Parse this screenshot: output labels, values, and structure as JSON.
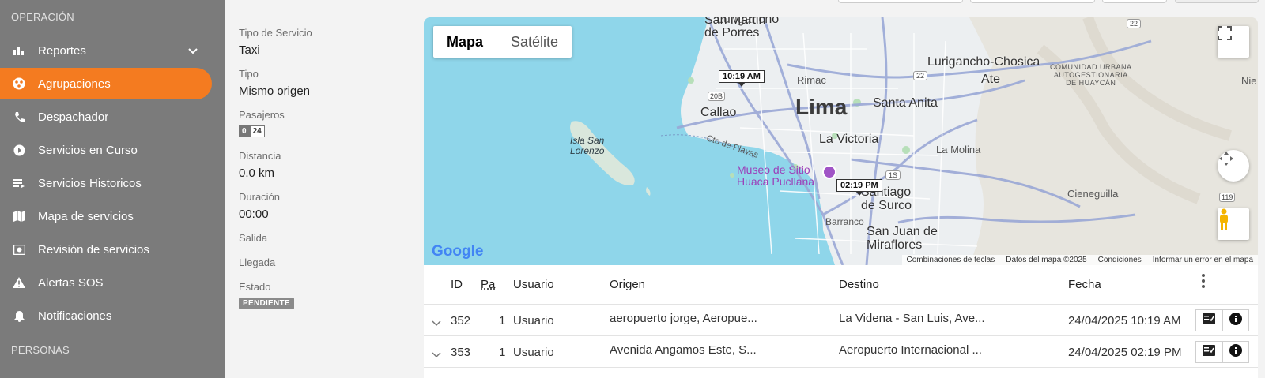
{
  "sidebar": {
    "section_operacion": "OPERACIÓN",
    "section_personas": "PERSONAS",
    "items": [
      {
        "label": "Reportes"
      },
      {
        "label": "Agrupaciones"
      },
      {
        "label": "Despachador"
      },
      {
        "label": "Servicios en Curso"
      },
      {
        "label": "Servicios Historicos"
      },
      {
        "label": "Mapa de servicios"
      },
      {
        "label": "Revisión de servicios"
      },
      {
        "label": "Alertas SOS"
      },
      {
        "label": "Notificaciones"
      }
    ],
    "active_item": "Agrupaciones"
  },
  "details": {
    "tipo_servicio_label": "Tipo de Servicio",
    "tipo_servicio_value": "Taxi",
    "tipo_label": "Tipo",
    "tipo_value": "Mismo origen",
    "pasajeros_label": "Pasajeros",
    "pasajeros_count": "0",
    "pasajeros_capacity": "24",
    "distancia_label": "Distancia",
    "distancia_value": "0.0 km",
    "duracion_label": "Duración",
    "duracion_value": "00:00",
    "salida_label": "Salida",
    "llegada_label": "Llegada",
    "estado_label": "Estado",
    "estado_value": "PENDIENTE"
  },
  "map": {
    "type_map": "Mapa",
    "type_satellite": "Satélite",
    "labels": {
      "lurigancho": "Lurigancho",
      "san_martin": "San Martin\nde Porres",
      "rimac": "Rimac",
      "lima": "Lima",
      "santa_anita": "Santa Anita",
      "callao": "Callao",
      "lurigancho_chosica": "Lurigancho-Chosica",
      "ate": "Ate",
      "comunidad": "COMUNIDAD URBANA\nAUTOGESTIONARIA\nDE HUAYCÁN",
      "nie": "Nie",
      "isla": "Isla San\nLorenzo",
      "la_victoria": "La Victoria",
      "la_molina": "La Molina",
      "cto_playas": "Cto de Playas",
      "museo": "Museo de Sitio\nHuaca Pucllana",
      "santiago": "Santiago\nde Surco",
      "barranco": "Barranco",
      "san_juan": "San Juan de\nMiraflores",
      "cieneguilla": "Cieneguilla",
      "r20b": "20B",
      "r22a": "22",
      "r22b": "22",
      "r1s": "1S",
      "r119": "119"
    },
    "time_pickup": "10:19 AM",
    "time_dropoff": "02:19 PM",
    "attribution": {
      "keys": "Combinaciones de teclas",
      "data": "Datos del mapa ©2025",
      "terms": "Condiciones",
      "report": "Informar un error en el mapa"
    },
    "logo": "Google"
  },
  "table": {
    "headers": {
      "id": "ID",
      "pa": "Pa",
      "usuario": "Usuario",
      "origen": "Origen",
      "destino": "Destino",
      "fecha": "Fecha"
    },
    "rows": [
      {
        "id": "352",
        "pa": "1",
        "usuario": "Usuario",
        "origen": "aeropuerto jorge, Aeropue...",
        "destino": "La Videna - San Luis, Ave...",
        "fecha": "24/04/2025 10:19 AM"
      },
      {
        "id": "353",
        "pa": "1",
        "usuario": "Usuario",
        "origen": "Avenida Angamos Este, S...",
        "destino": "Aeropuerto Internacional ...",
        "fecha": "24/04/2025 02:19 PM"
      }
    ]
  },
  "colors": {
    "accent": "#f47b20",
    "sidebar": "#7b7b7b",
    "water": "#8fd6ea",
    "land": "#eceff1"
  },
  "icons": [
    "bar-chart-icon",
    "chevron-down-icon",
    "group-icon",
    "phone-dispatch-icon",
    "live-service-icon",
    "history-list-icon",
    "map-icon",
    "review-icon",
    "warning-icon",
    "bell-icon",
    "fullscreen-icon",
    "pan-control-icon",
    "pegman-icon",
    "more-vert-icon",
    "expand-row-icon",
    "checklist-icon",
    "info-icon"
  ]
}
